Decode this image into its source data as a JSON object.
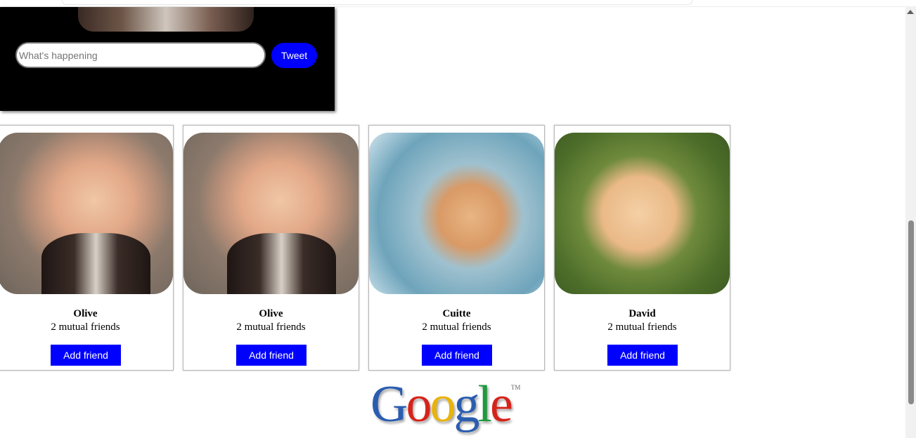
{
  "composer": {
    "placeholder": "What's happening",
    "tweet_label": "Tweet"
  },
  "friends": [
    {
      "name": "Olive",
      "mutual": "2 mutual friends",
      "button": "Add friend"
    },
    {
      "name": "Olive",
      "mutual": "2 mutual friends",
      "button": "Add friend"
    },
    {
      "name": "Cuitte",
      "mutual": "2 mutual friends",
      "button": "Add friend"
    },
    {
      "name": "David",
      "mutual": "2 mutual friends",
      "button": "Add friend"
    }
  ],
  "logo": {
    "letters": [
      "G",
      "o",
      "o",
      "g",
      "l",
      "e"
    ],
    "colors": [
      "#2a5db0",
      "#d6231a",
      "#e9b308",
      "#2a5db0",
      "#1f9a3d",
      "#d6231a"
    ],
    "tm": "TM"
  },
  "colors": {
    "accent": "#0000ff",
    "panel": "#000000"
  }
}
